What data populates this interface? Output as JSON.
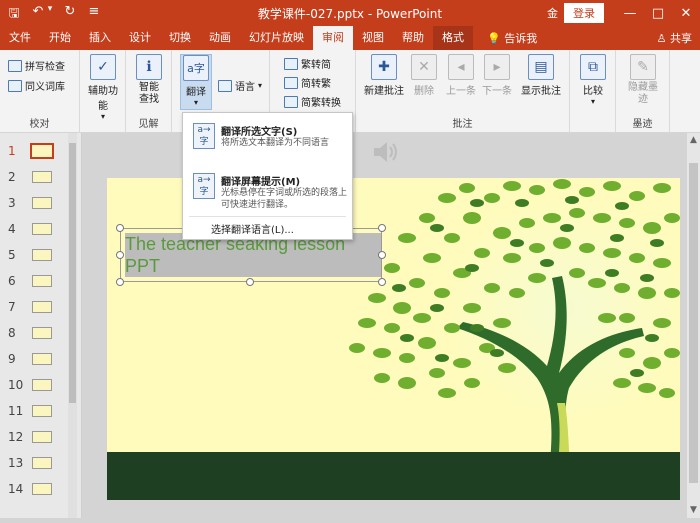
{
  "titlebar": {
    "document_title": "教学课件-027.pptx  -  PowerPoint",
    "account_truncated": "金",
    "login_label": "登录",
    "minimize_glyph": "—",
    "restore_glyph": "□",
    "close_glyph": "✕",
    "qat": {
      "save": "🖫",
      "undo": "↶",
      "undo_arrow": "▾",
      "repeat": "↻",
      "customize": "≡"
    }
  },
  "tabs": [
    {
      "label": "文件"
    },
    {
      "label": "开始"
    },
    {
      "label": "插入"
    },
    {
      "label": "设计"
    },
    {
      "label": "切换"
    },
    {
      "label": "动画"
    },
    {
      "label": "幻灯片放映"
    },
    {
      "label": "审阅"
    },
    {
      "label": "视图"
    },
    {
      "label": "帮助"
    },
    {
      "label": "格式"
    }
  ],
  "tell_me": "💡 告诉我",
  "share": "♙ 共享",
  "ribbon": {
    "proofing": {
      "spell": "拼写检查",
      "thesaurus": "同义词库",
      "label": "校对"
    },
    "accessibility": {
      "check": "辅助功能",
      "arrow": "▾"
    },
    "insights": {
      "smart_lookup": "智能查找",
      "label": "见解"
    },
    "language": {
      "translate": "翻译",
      "translate_arrow": "▾",
      "language": "语言",
      "language_arrow": "▾"
    },
    "chinese": {
      "t2s": "繁转简",
      "s2t": "简转繁",
      "convert": "简繁转换"
    },
    "comments": {
      "new": "新建批注",
      "delete": "删除",
      "prev": "上一条",
      "next": "下一条",
      "show": "显示批注",
      "label": "批注"
    },
    "compare": {
      "compare": "比较",
      "arrow": "▾"
    },
    "ink": {
      "hide": "隐藏墨迹",
      "label": "墨迹"
    }
  },
  "dropdown": {
    "item1_title": "翻译所选文字(S)",
    "item1_desc": "将所选文本翻译为不同语言",
    "item2_title": "翻译屏幕提示(M)",
    "item2_desc": "光标悬停在字词或所选的段落上可快速进行翻译。",
    "item3_label": "选择翻译语言(L)...",
    "icon_text": "a→字"
  },
  "thumbnails": [
    "1",
    "2",
    "3",
    "4",
    "5",
    "6",
    "7",
    "8",
    "9",
    "10",
    "11",
    "12",
    "13",
    "14"
  ],
  "slide": {
    "text": "The teacher seaking lesson PPT"
  },
  "colors": {
    "accent": "#c43e1c",
    "slide_bg": "#fffbbd",
    "leaf": "#6fae2e",
    "trunk": "#2f6b2a"
  }
}
